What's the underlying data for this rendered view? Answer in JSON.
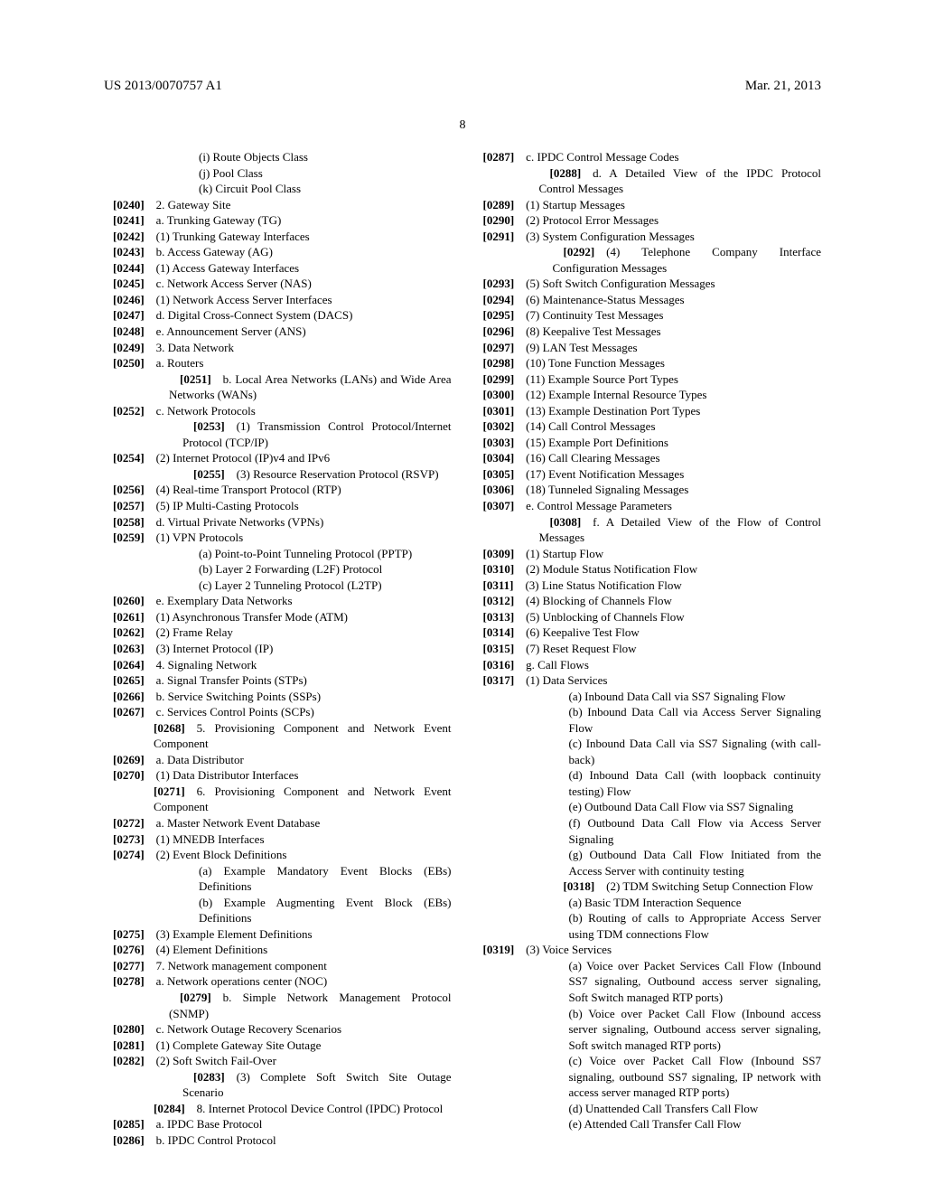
{
  "header": {
    "doc_number": "US 2013/0070757 A1",
    "date": "Mar. 21, 2013",
    "page_number": "8"
  },
  "entries": [
    {
      "cls": "i4nop",
      "text": "(i) Route Objects Class"
    },
    {
      "cls": "i4nop",
      "text": "(j) Pool Class"
    },
    {
      "cls": "i4nop",
      "text": "(k) Circuit Pool Class"
    },
    {
      "cls": "i1f",
      "para": "[0240]",
      "text": "2. Gateway Site"
    },
    {
      "cls": "i2f",
      "para": "[0241]",
      "text": "a. Trunking Gateway (TG)"
    },
    {
      "cls": "i3f",
      "para": "[0242]",
      "text": "(1) Trunking Gateway Interfaces"
    },
    {
      "cls": "i2f",
      "para": "[0243]",
      "text": "b. Access Gateway (AG)"
    },
    {
      "cls": "i3f",
      "para": "[0244]",
      "text": "(1) Access Gateway Interfaces"
    },
    {
      "cls": "i2f",
      "para": "[0245]",
      "text": "c. Network Access Server (NAS)"
    },
    {
      "cls": "i3f",
      "para": "[0246]",
      "text": "(1) Network Access Server Interfaces"
    },
    {
      "cls": "i2f",
      "para": "[0247]",
      "text": "d. Digital Cross-Connect System (DACS)"
    },
    {
      "cls": "i2f",
      "para": "[0248]",
      "text": "e. Announcement Server (ANS)"
    },
    {
      "cls": "i1f",
      "para": "[0249]",
      "text": "3. Data Network"
    },
    {
      "cls": "i2f",
      "para": "[0250]",
      "text": "a. Routers"
    },
    {
      "cls": "i2j",
      "para": "[0251]",
      "text": "b. Local Area Networks (LANs) and Wide Area Networks (WANs)"
    },
    {
      "cls": "i2f",
      "para": "[0252]",
      "text": "c. Network Protocols"
    },
    {
      "cls": "i3j",
      "para": "[0253]",
      "text": "(1) Transmission Control Protocol/Internet Protocol (TCP/IP)"
    },
    {
      "cls": "i3f",
      "para": "[0254]",
      "text": "(2) Internet Protocol (IP)v4 and IPv6"
    },
    {
      "cls": "i3j",
      "para": "[0255]",
      "text": "(3) Resource Reservation Protocol (RSVP)"
    },
    {
      "cls": "i3f",
      "para": "[0256]",
      "text": "(4) Real-time Transport Protocol (RTP)"
    },
    {
      "cls": "i3f",
      "para": "[0257]",
      "text": "(5) IP Multi-Casting Protocols"
    },
    {
      "cls": "i2f",
      "para": "[0258]",
      "text": "d. Virtual Private Networks (VPNs)"
    },
    {
      "cls": "i3f",
      "para": "[0259]",
      "text": "(1) VPN Protocols"
    },
    {
      "cls": "i4nop",
      "text": "(a) Point-to-Point Tunneling Protocol (PPTP)"
    },
    {
      "cls": "i4nop",
      "text": "(b) Layer 2 Forwarding (L2F) Protocol"
    },
    {
      "cls": "i4nop",
      "text": "(c) Layer 2 Tunneling Protocol (L2TP)"
    },
    {
      "cls": "i2f",
      "para": "[0260]",
      "text": "e. Exemplary Data Networks"
    },
    {
      "cls": "i3f",
      "para": "[0261]",
      "text": "(1) Asynchronous Transfer Mode (ATM)"
    },
    {
      "cls": "i3f",
      "para": "[0262]",
      "text": "(2) Frame Relay"
    },
    {
      "cls": "i3f",
      "para": "[0263]",
      "text": "(3) Internet Protocol (IP)"
    },
    {
      "cls": "i1f",
      "para": "[0264]",
      "text": "4. Signaling Network"
    },
    {
      "cls": "i2f",
      "para": "[0265]",
      "text": "a. Signal Transfer Points (STPs)"
    },
    {
      "cls": "i2f",
      "para": "[0266]",
      "text": "b. Service Switching Points (SSPs)"
    },
    {
      "cls": "i2f",
      "para": "[0267]",
      "text": "c. Services Control Points (SCPs)"
    },
    {
      "cls": "i1",
      "para": "[0268]",
      "text": "5. Provisioning Component and Network Event Component"
    },
    {
      "cls": "i2f",
      "para": "[0269]",
      "text": "a. Data Distributor"
    },
    {
      "cls": "i3f",
      "para": "[0270]",
      "text": "(1) Data Distributor Interfaces"
    },
    {
      "cls": "i1",
      "para": "[0271]",
      "text": "6. Provisioning Component and Network Event Component"
    },
    {
      "cls": "i2f",
      "para": "[0272]",
      "text": "a. Master Network Event Database"
    },
    {
      "cls": "i3f",
      "para": "[0273]",
      "text": "(1) MNEDB Interfaces"
    },
    {
      "cls": "i3f",
      "para": "[0274]",
      "text": "(2) Event Block Definitions"
    },
    {
      "cls": "i4nop",
      "text": "(a) Example Mandatory Event Blocks (EBs) Definitions"
    },
    {
      "cls": "i4nop",
      "text": "(b) Example Augmenting Event Block (EBs) Definitions"
    },
    {
      "cls": "i3f",
      "para": "[0275]",
      "text": "(3) Example Element Definitions"
    },
    {
      "cls": "i3f",
      "para": "[0276]",
      "text": "(4) Element Definitions"
    },
    {
      "cls": "i1f",
      "para": "[0277]",
      "text": "7. Network management component"
    },
    {
      "cls": "i2f",
      "para": "[0278]",
      "text": "a. Network operations center (NOC)"
    },
    {
      "cls": "i2j",
      "para": "[0279]",
      "text": "b. Simple Network Management Protocol (SNMP)"
    },
    {
      "cls": "i2f",
      "para": "[0280]",
      "text": "c. Network Outage Recovery Scenarios"
    },
    {
      "cls": "i3f",
      "para": "[0281]",
      "text": "(1) Complete Gateway Site Outage"
    },
    {
      "cls": "i3f",
      "para": "[0282]",
      "text": "(2) Soft Switch Fail-Over"
    },
    {
      "cls": "i3j",
      "para": "[0283]",
      "text": "(3) Complete Soft Switch Site Outage Scenario"
    },
    {
      "cls": "i1",
      "para": "[0284]",
      "text": "8. Internet Protocol Device Control (IPDC) Protocol"
    },
    {
      "cls": "i2f",
      "para": "[0285]",
      "text": "a. IPDC Base Protocol"
    },
    {
      "cls": "i2f lastentry",
      "para": "[0286]",
      "text": "b. IPDC Control Protocol"
    },
    {
      "cls": "i2f",
      "para": "[0287]",
      "text": "c. IPDC Control Message Codes"
    },
    {
      "cls": "i2j",
      "para": "[0288]",
      "text": "d. A Detailed View of the IPDC Protocol Control Messages"
    },
    {
      "cls": "i3f",
      "para": "[0289]",
      "text": "(1) Startup Messages"
    },
    {
      "cls": "i3f",
      "para": "[0290]",
      "text": "(2) Protocol Error Messages"
    },
    {
      "cls": "i3f",
      "para": "[0291]",
      "text": "(3) System Configuration Messages"
    },
    {
      "cls": "i3j",
      "para": "[0292]",
      "text": "(4) Telephone Company Interface Configuration Messages"
    },
    {
      "cls": "i3f",
      "para": "[0293]",
      "text": "(5) Soft Switch Configuration Messages"
    },
    {
      "cls": "i3f",
      "para": "[0294]",
      "text": "(6) Maintenance-Status Messages"
    },
    {
      "cls": "i3f",
      "para": "[0295]",
      "text": "(7) Continuity Test Messages"
    },
    {
      "cls": "i3f",
      "para": "[0296]",
      "text": "(8) Keepalive Test Messages"
    },
    {
      "cls": "i3f",
      "para": "[0297]",
      "text": "(9) LAN Test Messages"
    },
    {
      "cls": "i3f",
      "para": "[0298]",
      "text": "(10) Tone Function Messages"
    },
    {
      "cls": "i3f",
      "para": "[0299]",
      "text": "(11) Example Source Port Types"
    },
    {
      "cls": "i3f",
      "para": "[0300]",
      "text": "(12) Example Internal Resource Types"
    },
    {
      "cls": "i3f",
      "para": "[0301]",
      "text": "(13) Example Destination Port Types"
    },
    {
      "cls": "i3f",
      "para": "[0302]",
      "text": "(14) Call Control Messages"
    },
    {
      "cls": "i3f",
      "para": "[0303]",
      "text": "(15) Example Port Definitions"
    },
    {
      "cls": "i3f",
      "para": "[0304]",
      "text": "(16) Call Clearing Messages"
    },
    {
      "cls": "i3f",
      "para": "[0305]",
      "text": "(17) Event Notification Messages"
    },
    {
      "cls": "i3f",
      "para": "[0306]",
      "text": "(18) Tunneled Signaling Messages"
    },
    {
      "cls": "i2f",
      "para": "[0307]",
      "text": "e. Control Message Parameters"
    },
    {
      "cls": "i2j",
      "para": "[0308]",
      "text": "f. A Detailed View of the Flow of Control Messages"
    },
    {
      "cls": "i3f",
      "para": "[0309]",
      "text": "(1) Startup Flow"
    },
    {
      "cls": "i3f",
      "para": "[0310]",
      "text": "(2) Module Status Notification Flow"
    },
    {
      "cls": "i3f",
      "para": "[0311]",
      "text": "(3) Line Status Notification Flow"
    },
    {
      "cls": "i3f",
      "para": "[0312]",
      "text": "(4) Blocking of Channels Flow"
    },
    {
      "cls": "i3f",
      "para": "[0313]",
      "text": "(5) Unblocking of Channels Flow"
    },
    {
      "cls": "i3f",
      "para": "[0314]",
      "text": "(6) Keepalive Test Flow"
    },
    {
      "cls": "i3f",
      "para": "[0315]",
      "text": "(7) Reset Request Flow"
    },
    {
      "cls": "i2f",
      "para": "[0316]",
      "text": "g. Call Flows"
    },
    {
      "cls": "i3f",
      "para": "[0317]",
      "text": "(1) Data Services"
    },
    {
      "cls": "i4nop",
      "text": "(a) Inbound Data Call via SS7 Signaling Flow"
    },
    {
      "cls": "i4nop",
      "text": "(b) Inbound Data Call via Access Server Signaling Flow"
    },
    {
      "cls": "i4nop",
      "text": "(c) Inbound Data Call via SS7 Signaling (with call-back)"
    },
    {
      "cls": "i4nop",
      "text": "(d) Inbound Data Call (with loopback continuity testing) Flow"
    },
    {
      "cls": "i4nop",
      "text": "(e) Outbound Data Call Flow via SS7 Signaling"
    },
    {
      "cls": "i4nop",
      "text": "(f) Outbound Data Call Flow via Access Server Signaling"
    },
    {
      "cls": "i4nop",
      "text": "(g) Outbound Data Call Flow Initiated from the Access Server with continuity testing"
    },
    {
      "cls": "i3j",
      "para": "[0318]",
      "text": "(2) TDM Switching Setup Connection Flow"
    },
    {
      "cls": "i4nop",
      "text": "(a) Basic TDM Interaction Sequence"
    },
    {
      "cls": "i4nop",
      "text": "(b) Routing of calls to Appropriate Access Server using TDM connections Flow"
    },
    {
      "cls": "i3f",
      "para": "[0319]",
      "text": "(3) Voice Services"
    },
    {
      "cls": "i4nop",
      "text": "(a) Voice over Packet Services Call Flow (Inbound SS7 signaling, Outbound access server signaling, Soft Switch managed RTP ports)"
    },
    {
      "cls": "i4nop",
      "text": "(b) Voice over Packet Call Flow (Inbound access server signaling, Outbound access server signaling, Soft switch managed RTP ports)"
    },
    {
      "cls": "i4nop",
      "text": "(c) Voice over Packet Call Flow (Inbound SS7 signaling, outbound SS7 signaling, IP network with access server managed RTP ports)"
    },
    {
      "cls": "i4nop",
      "text": "(d) Unattended Call Transfers Call Flow"
    },
    {
      "cls": "i4nop",
      "text": "(e) Attended Call Transfer Call Flow"
    }
  ]
}
